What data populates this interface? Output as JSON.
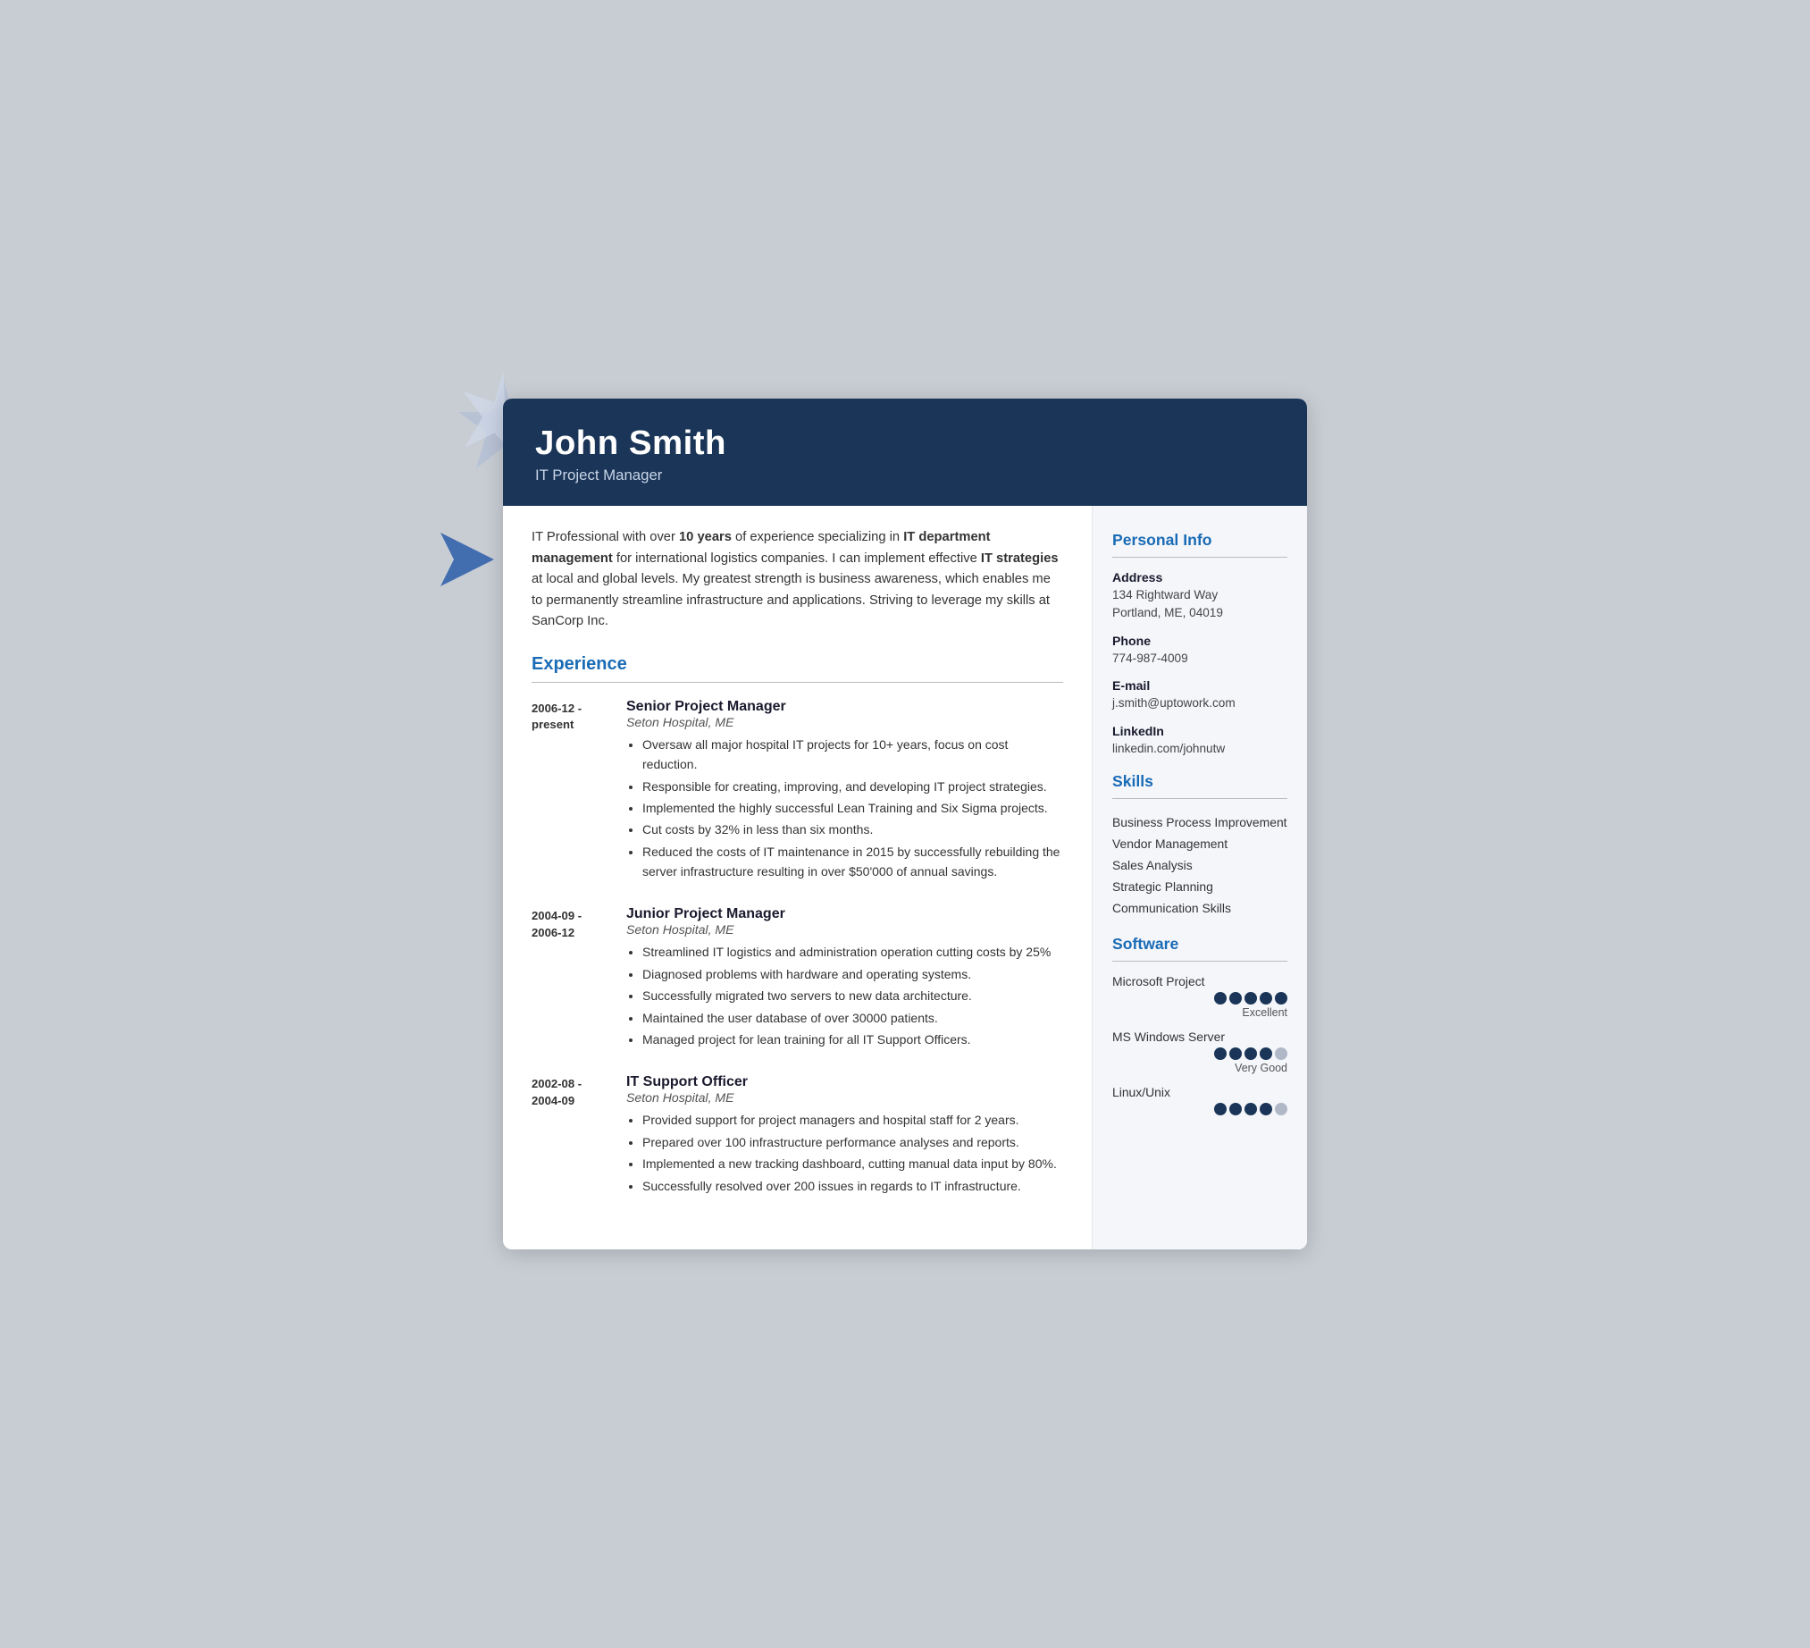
{
  "header": {
    "name": "John Smith",
    "title": "IT Project Manager"
  },
  "summary": {
    "text_parts": [
      {
        "text": "IT Professional with over ",
        "bold": false
      },
      {
        "text": "10 years",
        "bold": true
      },
      {
        "text": " of experience specializing in ",
        "bold": false
      },
      {
        "text": "IT department management",
        "bold": true
      },
      {
        "text": " for international logistics companies. I can implement effective ",
        "bold": false
      },
      {
        "text": "IT strategies",
        "bold": true
      },
      {
        "text": " at local and global levels. My greatest strength is business awareness, which enables me to permanently streamline infrastructure and applications. Striving to leverage my skills at SanCorp Inc.",
        "bold": false
      }
    ]
  },
  "experience": {
    "section_label": "Experience",
    "entries": [
      {
        "date": "2006-12 -\npresent",
        "title": "Senior Project Manager",
        "company": "Seton Hospital, ME",
        "bullets": [
          "Oversaw all major hospital IT projects for 10+ years, focus on cost reduction.",
          "Responsible for creating, improving, and developing IT project strategies.",
          "Implemented the highly successful Lean Training and Six Sigma projects.",
          "Cut costs by 32% in less than six months.",
          "Reduced the costs of IT maintenance in 2015 by successfully rebuilding the server infrastructure resulting in over $50'000 of annual savings."
        ]
      },
      {
        "date": "2004-09 -\n2006-12",
        "title": "Junior Project Manager",
        "company": "Seton Hospital, ME",
        "bullets": [
          "Streamlined IT logistics and administration operation cutting costs by 25%",
          "Diagnosed problems with hardware and operating systems.",
          "Successfully migrated two servers to new data architecture.",
          "Maintained the user database of over 30000 patients.",
          "Managed project for lean training for all IT Support Officers."
        ]
      },
      {
        "date": "2002-08 -\n2004-09",
        "title": "IT Support Officer",
        "company": "Seton Hospital, ME",
        "bullets": [
          "Provided support for project managers and hospital staff for 2 years.",
          "Prepared over 100 infrastructure performance analyses and reports.",
          "Implemented a new tracking dashboard, cutting manual data input by 80%.",
          "Successfully resolved over 200 issues in regards to IT infrastructure."
        ]
      }
    ]
  },
  "sidebar": {
    "personal_info": {
      "section_label": "Personal Info",
      "address_label": "Address",
      "address_value": "134 Rightward Way\nPortland, ME, 04019",
      "phone_label": "Phone",
      "phone_value": "774-987-4009",
      "email_label": "E-mail",
      "email_value": "j.smith@uptowork.com",
      "linkedin_label": "LinkedIn",
      "linkedin_value": "linkedin.com/johnutw"
    },
    "skills": {
      "section_label": "Skills",
      "items": [
        "Business Process Improvement",
        "Vendor Management",
        "Sales Analysis",
        "Strategic Planning",
        "Communication Skills"
      ]
    },
    "software": {
      "section_label": "Software",
      "items": [
        {
          "name": "Microsoft Project",
          "filled": 5,
          "total": 5,
          "label": "Excellent"
        },
        {
          "name": "MS Windows Server",
          "filled": 4,
          "total": 5,
          "label": "Very Good"
        },
        {
          "name": "Linux/Unix",
          "filled": 4,
          "total": 5,
          "label": ""
        }
      ]
    }
  }
}
